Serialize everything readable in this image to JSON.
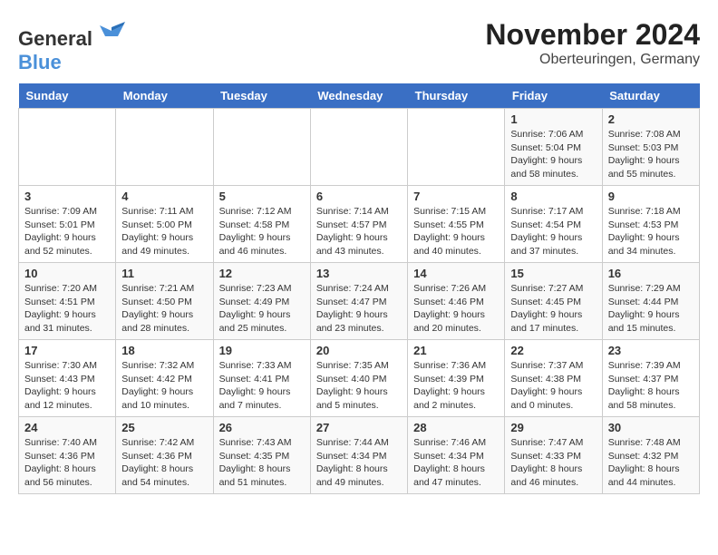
{
  "header": {
    "logo_general": "General",
    "logo_blue": "Blue",
    "month": "November 2024",
    "location": "Oberteuringen, Germany"
  },
  "days_of_week": [
    "Sunday",
    "Monday",
    "Tuesday",
    "Wednesday",
    "Thursday",
    "Friday",
    "Saturday"
  ],
  "weeks": [
    [
      {
        "day": "",
        "info": ""
      },
      {
        "day": "",
        "info": ""
      },
      {
        "day": "",
        "info": ""
      },
      {
        "day": "",
        "info": ""
      },
      {
        "day": "",
        "info": ""
      },
      {
        "day": "1",
        "info": "Sunrise: 7:06 AM\nSunset: 5:04 PM\nDaylight: 9 hours and 58 minutes."
      },
      {
        "day": "2",
        "info": "Sunrise: 7:08 AM\nSunset: 5:03 PM\nDaylight: 9 hours and 55 minutes."
      }
    ],
    [
      {
        "day": "3",
        "info": "Sunrise: 7:09 AM\nSunset: 5:01 PM\nDaylight: 9 hours and 52 minutes."
      },
      {
        "day": "4",
        "info": "Sunrise: 7:11 AM\nSunset: 5:00 PM\nDaylight: 9 hours and 49 minutes."
      },
      {
        "day": "5",
        "info": "Sunrise: 7:12 AM\nSunset: 4:58 PM\nDaylight: 9 hours and 46 minutes."
      },
      {
        "day": "6",
        "info": "Sunrise: 7:14 AM\nSunset: 4:57 PM\nDaylight: 9 hours and 43 minutes."
      },
      {
        "day": "7",
        "info": "Sunrise: 7:15 AM\nSunset: 4:55 PM\nDaylight: 9 hours and 40 minutes."
      },
      {
        "day": "8",
        "info": "Sunrise: 7:17 AM\nSunset: 4:54 PM\nDaylight: 9 hours and 37 minutes."
      },
      {
        "day": "9",
        "info": "Sunrise: 7:18 AM\nSunset: 4:53 PM\nDaylight: 9 hours and 34 minutes."
      }
    ],
    [
      {
        "day": "10",
        "info": "Sunrise: 7:20 AM\nSunset: 4:51 PM\nDaylight: 9 hours and 31 minutes."
      },
      {
        "day": "11",
        "info": "Sunrise: 7:21 AM\nSunset: 4:50 PM\nDaylight: 9 hours and 28 minutes."
      },
      {
        "day": "12",
        "info": "Sunrise: 7:23 AM\nSunset: 4:49 PM\nDaylight: 9 hours and 25 minutes."
      },
      {
        "day": "13",
        "info": "Sunrise: 7:24 AM\nSunset: 4:47 PM\nDaylight: 9 hours and 23 minutes."
      },
      {
        "day": "14",
        "info": "Sunrise: 7:26 AM\nSunset: 4:46 PM\nDaylight: 9 hours and 20 minutes."
      },
      {
        "day": "15",
        "info": "Sunrise: 7:27 AM\nSunset: 4:45 PM\nDaylight: 9 hours and 17 minutes."
      },
      {
        "day": "16",
        "info": "Sunrise: 7:29 AM\nSunset: 4:44 PM\nDaylight: 9 hours and 15 minutes."
      }
    ],
    [
      {
        "day": "17",
        "info": "Sunrise: 7:30 AM\nSunset: 4:43 PM\nDaylight: 9 hours and 12 minutes."
      },
      {
        "day": "18",
        "info": "Sunrise: 7:32 AM\nSunset: 4:42 PM\nDaylight: 9 hours and 10 minutes."
      },
      {
        "day": "19",
        "info": "Sunrise: 7:33 AM\nSunset: 4:41 PM\nDaylight: 9 hours and 7 minutes."
      },
      {
        "day": "20",
        "info": "Sunrise: 7:35 AM\nSunset: 4:40 PM\nDaylight: 9 hours and 5 minutes."
      },
      {
        "day": "21",
        "info": "Sunrise: 7:36 AM\nSunset: 4:39 PM\nDaylight: 9 hours and 2 minutes."
      },
      {
        "day": "22",
        "info": "Sunrise: 7:37 AM\nSunset: 4:38 PM\nDaylight: 9 hours and 0 minutes."
      },
      {
        "day": "23",
        "info": "Sunrise: 7:39 AM\nSunset: 4:37 PM\nDaylight: 8 hours and 58 minutes."
      }
    ],
    [
      {
        "day": "24",
        "info": "Sunrise: 7:40 AM\nSunset: 4:36 PM\nDaylight: 8 hours and 56 minutes."
      },
      {
        "day": "25",
        "info": "Sunrise: 7:42 AM\nSunset: 4:36 PM\nDaylight: 8 hours and 54 minutes."
      },
      {
        "day": "26",
        "info": "Sunrise: 7:43 AM\nSunset: 4:35 PM\nDaylight: 8 hours and 51 minutes."
      },
      {
        "day": "27",
        "info": "Sunrise: 7:44 AM\nSunset: 4:34 PM\nDaylight: 8 hours and 49 minutes."
      },
      {
        "day": "28",
        "info": "Sunrise: 7:46 AM\nSunset: 4:34 PM\nDaylight: 8 hours and 47 minutes."
      },
      {
        "day": "29",
        "info": "Sunrise: 7:47 AM\nSunset: 4:33 PM\nDaylight: 8 hours and 46 minutes."
      },
      {
        "day": "30",
        "info": "Sunrise: 7:48 AM\nSunset: 4:32 PM\nDaylight: 8 hours and 44 minutes."
      }
    ]
  ]
}
